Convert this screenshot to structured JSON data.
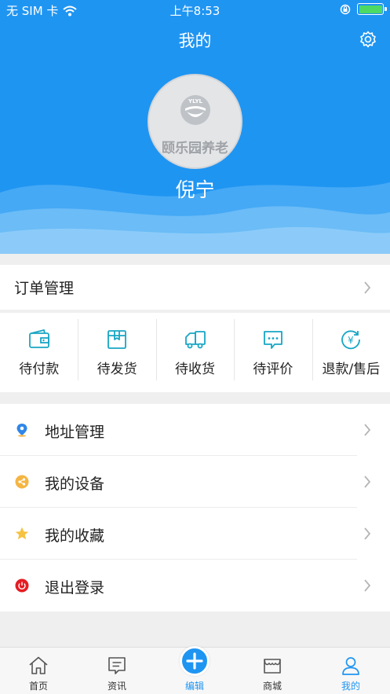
{
  "status_bar": {
    "carrier": "无 SIM 卡",
    "time": "上午8:53",
    "battery_level": 1.0
  },
  "header": {
    "title": "我的",
    "avatar_text": "颐乐园养老",
    "avatar_logo_text": "YLYL",
    "username": "倪宁"
  },
  "orders": {
    "label": "订单管理",
    "statuses": [
      {
        "label": "待付款",
        "icon": "wallet-icon"
      },
      {
        "label": "待发货",
        "icon": "package-icon"
      },
      {
        "label": "待收货",
        "icon": "truck-icon"
      },
      {
        "label": "待评价",
        "icon": "comment-icon"
      },
      {
        "label": "退款/售后",
        "icon": "refund-icon"
      }
    ]
  },
  "menu": {
    "items": [
      {
        "label": "地址管理",
        "icon": "location-pin-icon",
        "color": "#2f86e8"
      },
      {
        "label": "我的设备",
        "icon": "share-icon",
        "color": "#f5b542"
      },
      {
        "label": "我的收藏",
        "icon": "star-icon",
        "color": "#f5c342"
      },
      {
        "label": "退出登录",
        "icon": "power-icon",
        "color": "#e51c23"
      }
    ]
  },
  "tabbar": {
    "items": [
      {
        "label": "首页",
        "icon": "home-icon"
      },
      {
        "label": "资讯",
        "icon": "news-icon"
      },
      {
        "label": "编辑",
        "icon": "plus-icon"
      },
      {
        "label": "商城",
        "icon": "shop-icon"
      },
      {
        "label": "我的",
        "icon": "user-icon"
      }
    ],
    "active_index": 4
  },
  "colors": {
    "brand_blue": "#1f95f2",
    "icon_teal": "#18a6c4"
  }
}
